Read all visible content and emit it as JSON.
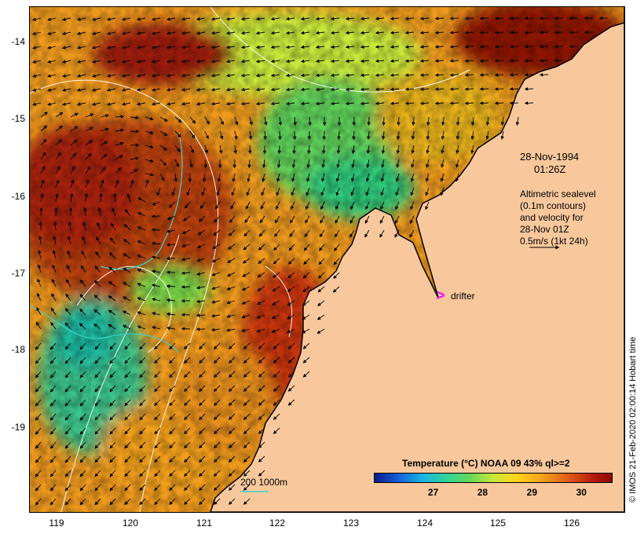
{
  "map": {
    "date": "28-Nov-1994",
    "time": "01:26Z",
    "altimetry_lines": [
      "Altimetric sealevel",
      "(0.1m contours)",
      "and velocity for",
      "28-Nov 01Z",
      "0.5m/s (1kt 24h)"
    ],
    "drifter_label": "drifter",
    "scale_label": "200  1000m",
    "credit": "© IMOS 21-Feb-2020 02:00:14 Hobart time",
    "lon_ticks": [
      "119",
      "120",
      "121",
      "122",
      "123",
      "124",
      "125",
      "126"
    ],
    "lat_ticks": [
      "-14",
      "-15",
      "-16",
      "-17",
      "-18",
      "-19"
    ],
    "lon_range": [
      118.65,
      126.7
    ],
    "lat_range": [
      -20.07,
      -13.55
    ],
    "colors": {
      "land": "#f8c89c",
      "hot": "#b51d0a",
      "warm": "#f09a1c",
      "cool": "#5fd05a",
      "cold": "#1fb8a0",
      "drifter": "#ff00ff"
    }
  },
  "colorbar": {
    "title": "Temperature (°C) NOAA 09 43% ql>=2",
    "ticks": [
      "27",
      "28",
      "29",
      "30"
    ],
    "tick_values": [
      27,
      28,
      29,
      30
    ],
    "range": [
      25.8,
      30.6
    ]
  }
}
